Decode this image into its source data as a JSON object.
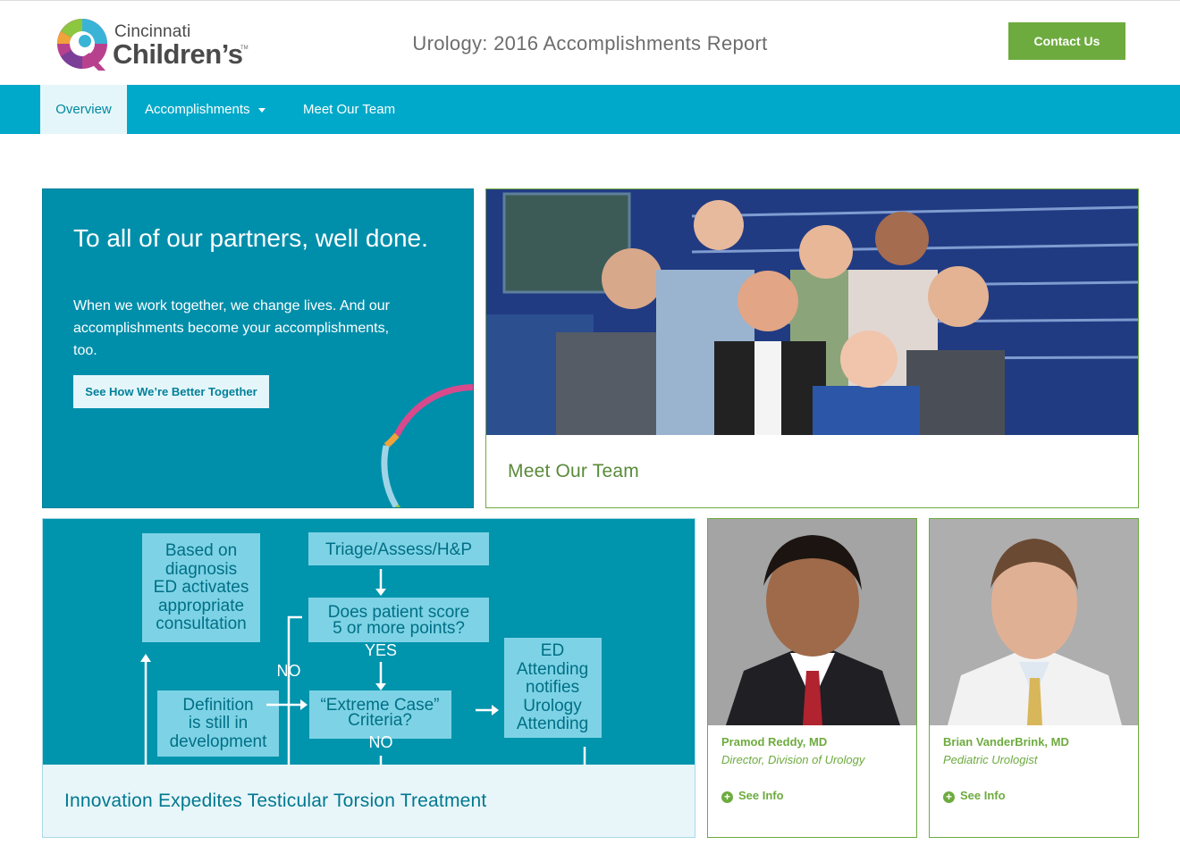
{
  "header": {
    "logo_line1": "Cincinnati",
    "logo_line2": "Children’s",
    "logo_tm": "TM",
    "report_title": "Urology: 2016 Accomplishments Report",
    "contact_label": "Contact Us"
  },
  "nav": {
    "items": [
      {
        "label": "Overview",
        "active": true
      },
      {
        "label": "Accomplishments",
        "has_dropdown": true
      },
      {
        "label": "Meet Our Team"
      }
    ]
  },
  "hero": {
    "heading": "To all of our partners, well done.",
    "body": "When we work together, we change lives. And our accomplishments become your accomplishments, too.",
    "button_label": "See How We’re Better Together"
  },
  "team_card": {
    "title": "Meet Our Team"
  },
  "flow_card": {
    "title": "Innovation Expedites Testicular Torsion Treatment",
    "flowchart": {
      "box_diagnosis": [
        "Based on",
        "diagnosis",
        "ED activates",
        "appropriate",
        "consultation"
      ],
      "box_triage": "Triage/Assess/H&P",
      "box_score": [
        "Does patient score",
        "5 or more points?"
      ],
      "label_yes": "YES",
      "label_no_left": "NO",
      "box_definition": [
        "Definition",
        "is still in",
        "development"
      ],
      "box_extreme": [
        "“Extreme Case”",
        "Criteria?"
      ],
      "label_no_bottom": "NO",
      "box_ed": [
        "ED",
        "Attending",
        "notifies",
        "Urology",
        "Attending"
      ]
    }
  },
  "people": [
    {
      "name": "Pramod Reddy, MD",
      "role": "Director, Division of Urology",
      "link": "See Info"
    },
    {
      "name": "Brian VanderBrink, MD",
      "role": "Pediatric Urologist",
      "link": "See Info"
    }
  ],
  "colors": {
    "teal_nav": "#00a9c9",
    "teal_dark": "#008fab",
    "green": "#6eab3f"
  },
  "icons": [
    "logo-mark",
    "caret-down-icon",
    "plus-circle-icon"
  ]
}
